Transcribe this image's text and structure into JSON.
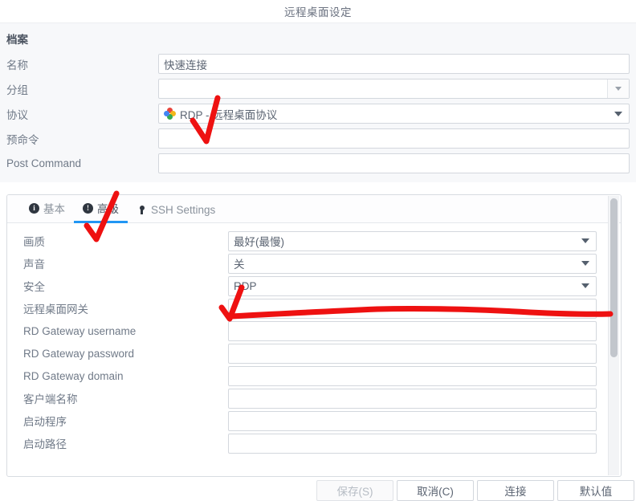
{
  "window": {
    "title": "远程桌面设定"
  },
  "profile": {
    "section_title": "档案",
    "fields": [
      {
        "label": "名称",
        "value": "快速连接"
      },
      {
        "label": "分组",
        "value": ""
      },
      {
        "label": "协议",
        "value": "RDP - 远程桌面协议"
      },
      {
        "label": "预命令",
        "value": ""
      },
      {
        "label": "Post Command",
        "value": ""
      }
    ]
  },
  "tabs": [
    {
      "label": "基本",
      "icon": "info-circle-icon",
      "glyph": "i",
      "active": false
    },
    {
      "label": "高级",
      "icon": "exclamation-circle-icon",
      "glyph": "!",
      "active": true
    },
    {
      "label": "SSH Settings",
      "icon": "key-icon",
      "glyph": "",
      "active": false
    }
  ],
  "advanced": {
    "rows": [
      {
        "label": "画质",
        "type": "combo",
        "value": "最好(最慢)"
      },
      {
        "label": "声音",
        "type": "combo",
        "value": "关"
      },
      {
        "label": "安全",
        "type": "combo",
        "value": "RDP"
      },
      {
        "label": "远程桌面网关",
        "type": "text",
        "value": ""
      },
      {
        "label": "RD Gateway username",
        "type": "text",
        "value": ""
      },
      {
        "label": "RD Gateway password",
        "type": "text",
        "value": ""
      },
      {
        "label": "RD Gateway domain",
        "type": "text",
        "value": ""
      },
      {
        "label": "客户端名称",
        "type": "text",
        "value": ""
      },
      {
        "label": "启动程序",
        "type": "text",
        "value": ""
      },
      {
        "label": "启动路径",
        "type": "text",
        "value": ""
      }
    ]
  },
  "footer": {
    "buttons": [
      {
        "label": "保存(S)",
        "disabled": true
      },
      {
        "label": "取消(C)",
        "disabled": false
      },
      {
        "label": "连接",
        "disabled": false
      },
      {
        "label": "默认值",
        "disabled": false
      }
    ]
  },
  "annotations": {
    "color": "#ee1111",
    "marks": [
      {
        "name": "checkmark-protocol"
      },
      {
        "name": "checkmark-advanced-tab"
      },
      {
        "name": "checkmark-security"
      },
      {
        "name": "underline-security"
      }
    ]
  },
  "scrollbar": {
    "orientation": "vertical"
  }
}
